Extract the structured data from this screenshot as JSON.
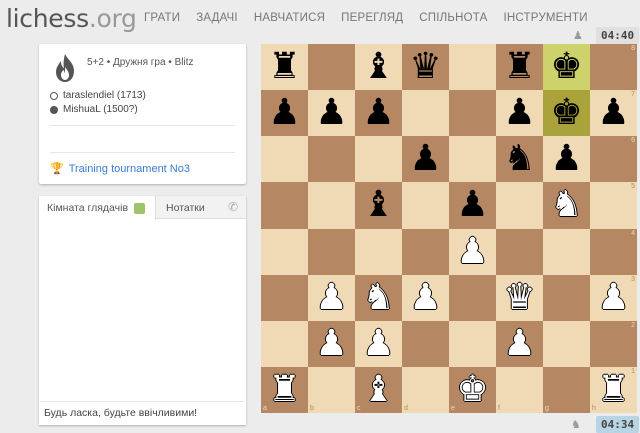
{
  "site": {
    "logo_main": "lichess",
    "logo_tld": ".org"
  },
  "nav": [
    "ГРАТИ",
    "ЗАДАЧІ",
    "НАВЧАТИСЯ",
    "ПЕРЕГЛЯД",
    "СПІЛЬНОТА",
    "ІНСТРУМЕНТИ"
  ],
  "game": {
    "meta": "5+2 • Дружня гра • Blitz",
    "white_player": "taraslendiel (1713)",
    "black_player": "MishuaL (1500?)",
    "tournament": "Training tournament No3"
  },
  "chat": {
    "tab_room": "Кімната глядачів",
    "tab_notes": "Нотатки",
    "placeholder": "Будь ласка, будьте ввічливими!"
  },
  "clocks": {
    "top": "04:40",
    "bottom": "04:34"
  },
  "board": {
    "ranks": [
      "r.bq.rk.",
      "ppp..pkp",
      "...p.np.",
      "..b.p.N.",
      "....P...",
      ".PNP.Q.P",
      ".PP..P..",
      "R.B.K..R"
    ],
    "highlight": [
      [
        0,
        6
      ],
      [
        1,
        6
      ]
    ],
    "rank_labels": [
      "8",
      "7",
      "6",
      "5",
      "4",
      "3",
      "2",
      "1"
    ],
    "file_labels": [
      "a",
      "b",
      "c",
      "d",
      "e",
      "f",
      "g",
      "h"
    ]
  },
  "icons": {
    "game_type": "flame-icon",
    "tournament": "trophy-icon",
    "phone": "phone-icon",
    "clock_flag": "pawn-icon"
  }
}
